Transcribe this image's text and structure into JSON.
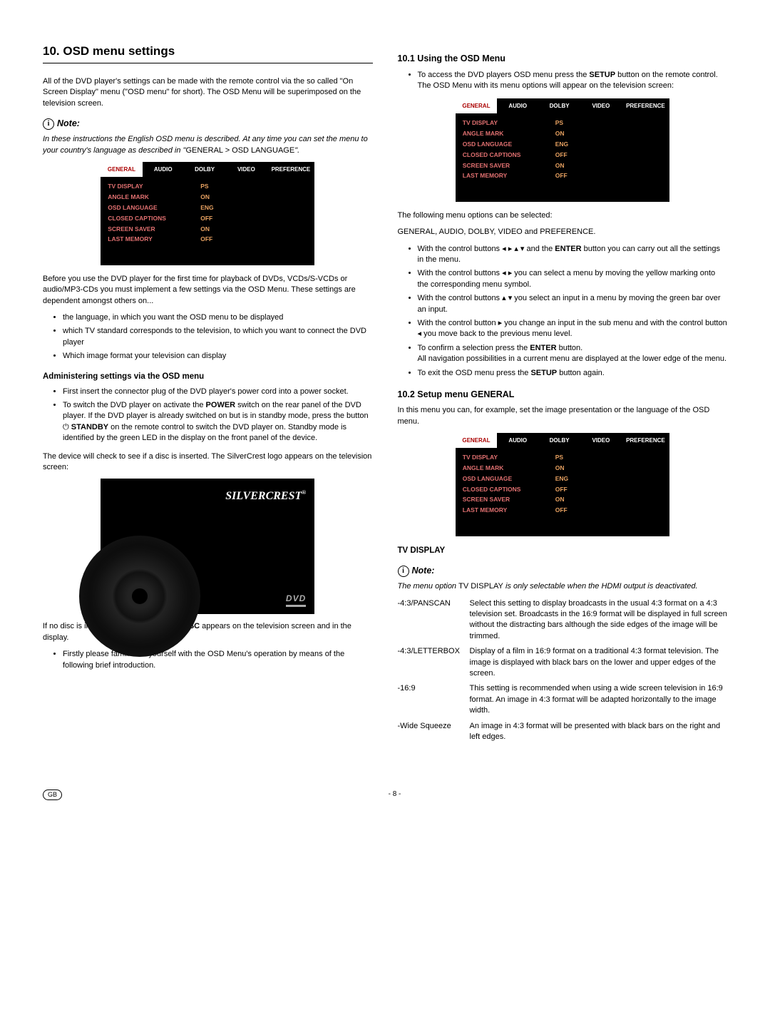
{
  "title": "10. OSD menu settings",
  "intro": "All of the DVD player's settings can be made with the remote control via the so called \"On Screen Display\" menu (\"OSD menu\" for short). The OSD Menu will be superimposed on the television screen.",
  "note_label": "Note:",
  "note1_a": "In these instructions the English OSD menu is described. At any time you can set the menu to your country's language as described in \"",
  "note1_b": "GENERAL > OSD LANGUAGE",
  "note1_c": "\".",
  "osd_tabs": [
    "GENERAL",
    "AUDIO",
    "DOLBY",
    "VIDEO",
    "PREFERENCE"
  ],
  "osd_rows": [
    [
      "TV DISPLAY",
      "PS"
    ],
    [
      "ANGLE MARK",
      "ON"
    ],
    [
      "OSD LANGUAGE",
      "ENG"
    ],
    [
      "CLOSED CAPTIONS",
      "OFF"
    ],
    [
      "SCREEN SAVER",
      "ON"
    ],
    [
      "LAST MEMORY",
      "OFF"
    ]
  ],
  "before": "Before you use the DVD player for the first time for playback of DVDs, VCDs/S-VCDs or audio/MP3-CDs you must implement a few settings via the OSD Menu. These settings are dependent amongst others on...",
  "before_items": [
    "the language, in which you want the OSD menu to be displayed",
    "which TV standard corresponds to the television, to which you want to connect the DVD player",
    "Which image format your television can display"
  ],
  "admin_head": "Administering settings via the OSD menu",
  "admin_items_1": "First insert the connector plug of the DVD player's power cord into a power socket.",
  "admin_items_2a": "To switch the DVD player on activate the ",
  "admin_items_2b": "POWER",
  "admin_items_2c": " switch on the rear panel of the DVD player. If the DVD player is already switched on but is in standby mode, press the button ",
  "admin_items_2d": " STANDBY",
  "admin_items_2e": " on the remote control to switch the DVD player on. Standby mode is identified by the green LED in the display on the front panel of the device.",
  "device_check": "The device will check to see if a disc is inserted. The SilverCrest logo appears on the television screen:",
  "brand": "SILVERCREST",
  "dvd_logo": "DVD",
  "nodisc": "If no disc is inserted the notification ",
  "nodisc_b": "NO DISC",
  "nodisc_c": " appears on the television screen and in the display.",
  "first_items": [
    "Firstly please familiarize yourself with the OSD Menu's operation by means of the following brief introduction."
  ],
  "s101_head": "10.1 Using the OSD Menu",
  "s101_item": "To access the DVD players OSD menu press the ",
  "s101_item_b": "SETUP",
  "s101_item_c": " button on the remote control. The OSD Menu with its menu options will appear on the television screen:",
  "s101_following": "The following menu options can be selected:",
  "s101_following2": "GENERAL, AUDIO, DOLBY, VIDEO and PREFERENCE.",
  "s101_bullets": {
    "b1a": "With the control buttons ",
    "b1b": " and the ",
    "b1c": "ENTER",
    "b1d": " button you can carry out all the settings in the menu.",
    "b2a": "With the control buttons ",
    "b2b": " you can select a menu by moving the yellow marking onto the corresponding menu symbol.",
    "b3a": "With the control buttons ",
    "b3b": " you select an input in a menu by moving the green bar over an input.",
    "b4a": "With the control button ",
    "b4b": " you change an input in the sub menu and with the control button ",
    "b4c": " you move back to the previous menu level.",
    "b5a": "To confirm a selection press the ",
    "b5b": "ENTER",
    "b5c": " button.",
    "b5d": "All navigation possibilities in a current menu are displayed at the lower edge of the menu.",
    "b6a": "To exit the OSD menu press the ",
    "b6b": "SETUP",
    "b6c": " button again."
  },
  "s102_head": "10.2 Setup menu GENERAL",
  "s102_intro": "In this menu you can, for example, set the image presentation or the language of the OSD menu.",
  "tvdisplay_head": "TV DISPLAY",
  "note2_a": "The menu option ",
  "note2_b": "TV DISPLAY",
  "note2_c": " is only selectable when the HDMI output is deactivated.",
  "defs": [
    {
      "term": "-4:3/PANSCAN",
      "desc": "Select this setting to display broadcasts in the usual 4:3 format on a 4:3 television set. Broadcasts in the 16:9 format will be displayed in full screen without the distracting bars although the side edges of the image will be trimmed."
    },
    {
      "term": "-4:3/LETTERBOX",
      "desc": "Display of a film in 16:9 format on a traditional 4:3 format television. The image is displayed with black bars on the lower and upper edges of the screen."
    },
    {
      "term": "-16:9",
      "desc": "This setting is recommended when using a wide screen television in 16:9 format. An image in 4:3 format will be adapted horizontally to the image width."
    },
    {
      "term": "-Wide Squeeze",
      "desc": "An image in 4:3 format will be presented with black bars on the right and left edges."
    }
  ],
  "footer_gb": "GB",
  "footer_page": "- 8 -"
}
